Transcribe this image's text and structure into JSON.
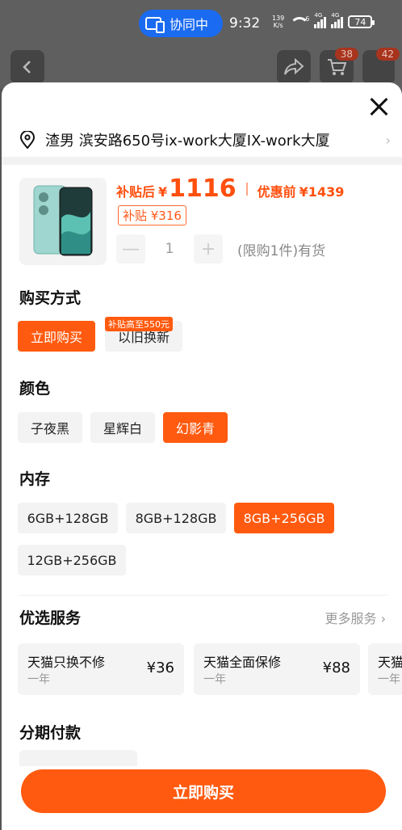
{
  "status_bar": {
    "collab_label": "协同中",
    "time": "9:32",
    "net_speed_value": "139",
    "net_speed_unit": "K/s",
    "wifi_label": "6",
    "signal1_label": "4G",
    "signal2_label": "4G",
    "battery": "74"
  },
  "nav": {
    "cart_badge": "38",
    "more_badge": "42"
  },
  "address": {
    "text": "渣男 滨安路650号ix-work大厦IX-work大厦"
  },
  "product": {
    "after_subsidy_label": "补贴后",
    "currency": "¥",
    "after_subsidy_price": "1116",
    "before_label": "优惠前",
    "before_price": "¥1439",
    "subsidy_tag": "补贴 ¥316",
    "quantity": "1",
    "minus": "—",
    "plus": "+",
    "limit_text": "(限购1件)有货"
  },
  "purchase_method": {
    "title": "购买方式",
    "options": [
      "立即购买",
      "以旧换新"
    ],
    "trade_in_tag": "补贴高至550元"
  },
  "color": {
    "title": "颜色",
    "options": [
      "子夜黑",
      "星辉白",
      "幻影青"
    ]
  },
  "storage": {
    "title": "内存",
    "options": [
      "6GB+128GB",
      "8GB+128GB",
      "8GB+256GB",
      "12GB+256GB"
    ]
  },
  "services": {
    "title": "优选服务",
    "more_label": "更多服务",
    "items": [
      {
        "name": "天猫只换不修",
        "term": "一年",
        "price": "¥36"
      },
      {
        "name": "天猫全面保修",
        "term": "一年",
        "price": "¥88"
      },
      {
        "name": "天猫",
        "term": "一年",
        "price": ""
      }
    ]
  },
  "installment": {
    "title": "分期付款"
  },
  "cta": {
    "buy_now": "立即购买"
  },
  "colors": {
    "accent": "#ff5a0f",
    "chip_bg": "#f3f3f3"
  }
}
